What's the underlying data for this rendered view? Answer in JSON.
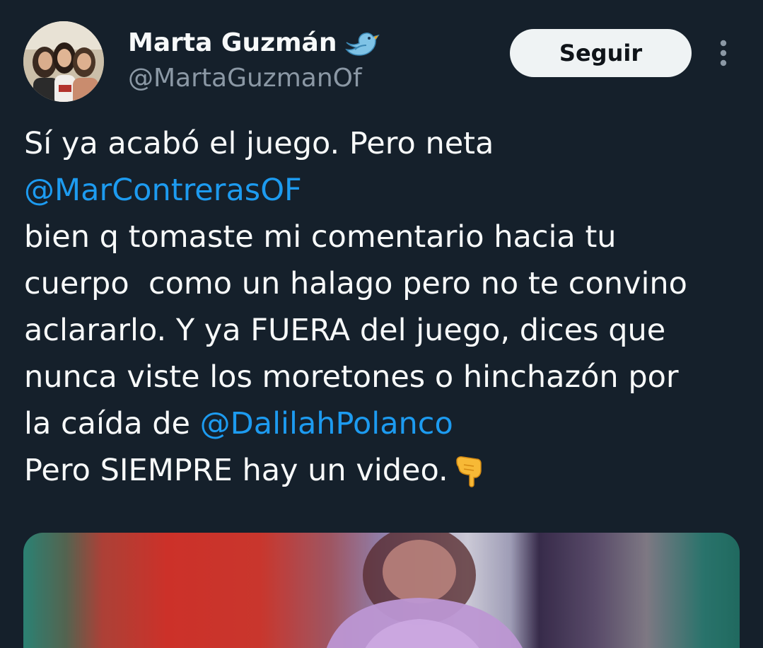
{
  "author": {
    "display_name": "Marta Guzmán",
    "handle": "@MartaGuzmanOf",
    "badge_icon": "bird-icon",
    "avatar_alt": "profile-photo"
  },
  "follow_button": {
    "label": "Seguir"
  },
  "more_menu_icon": "vertical-dots-icon",
  "tweet": {
    "line1": "Sí ya acabó el juego. Pero neta",
    "mention1": "@MarContrerasOF",
    "line3": "bien q tomaste mi comentario hacia tu",
    "line4": "cuerpo  como un halago pero no te convino",
    "line5": "aclararlo. Y ya FUERA del juego, dices que",
    "line6": "nunca viste los moretones o hinchazón por",
    "line7_prefix": "la caída de ",
    "mention2": "@DalilahPolanco",
    "line8": "Pero SIEMPRE hay un video.",
    "emoji": "point-down-hand-icon"
  },
  "media": {
    "type": "video-thumbnail"
  },
  "colors": {
    "background": "#15202b",
    "text": "#f7f9f9",
    "secondary": "#8b98a5",
    "link": "#1d9bf0",
    "button_bg": "#eff3f4"
  }
}
